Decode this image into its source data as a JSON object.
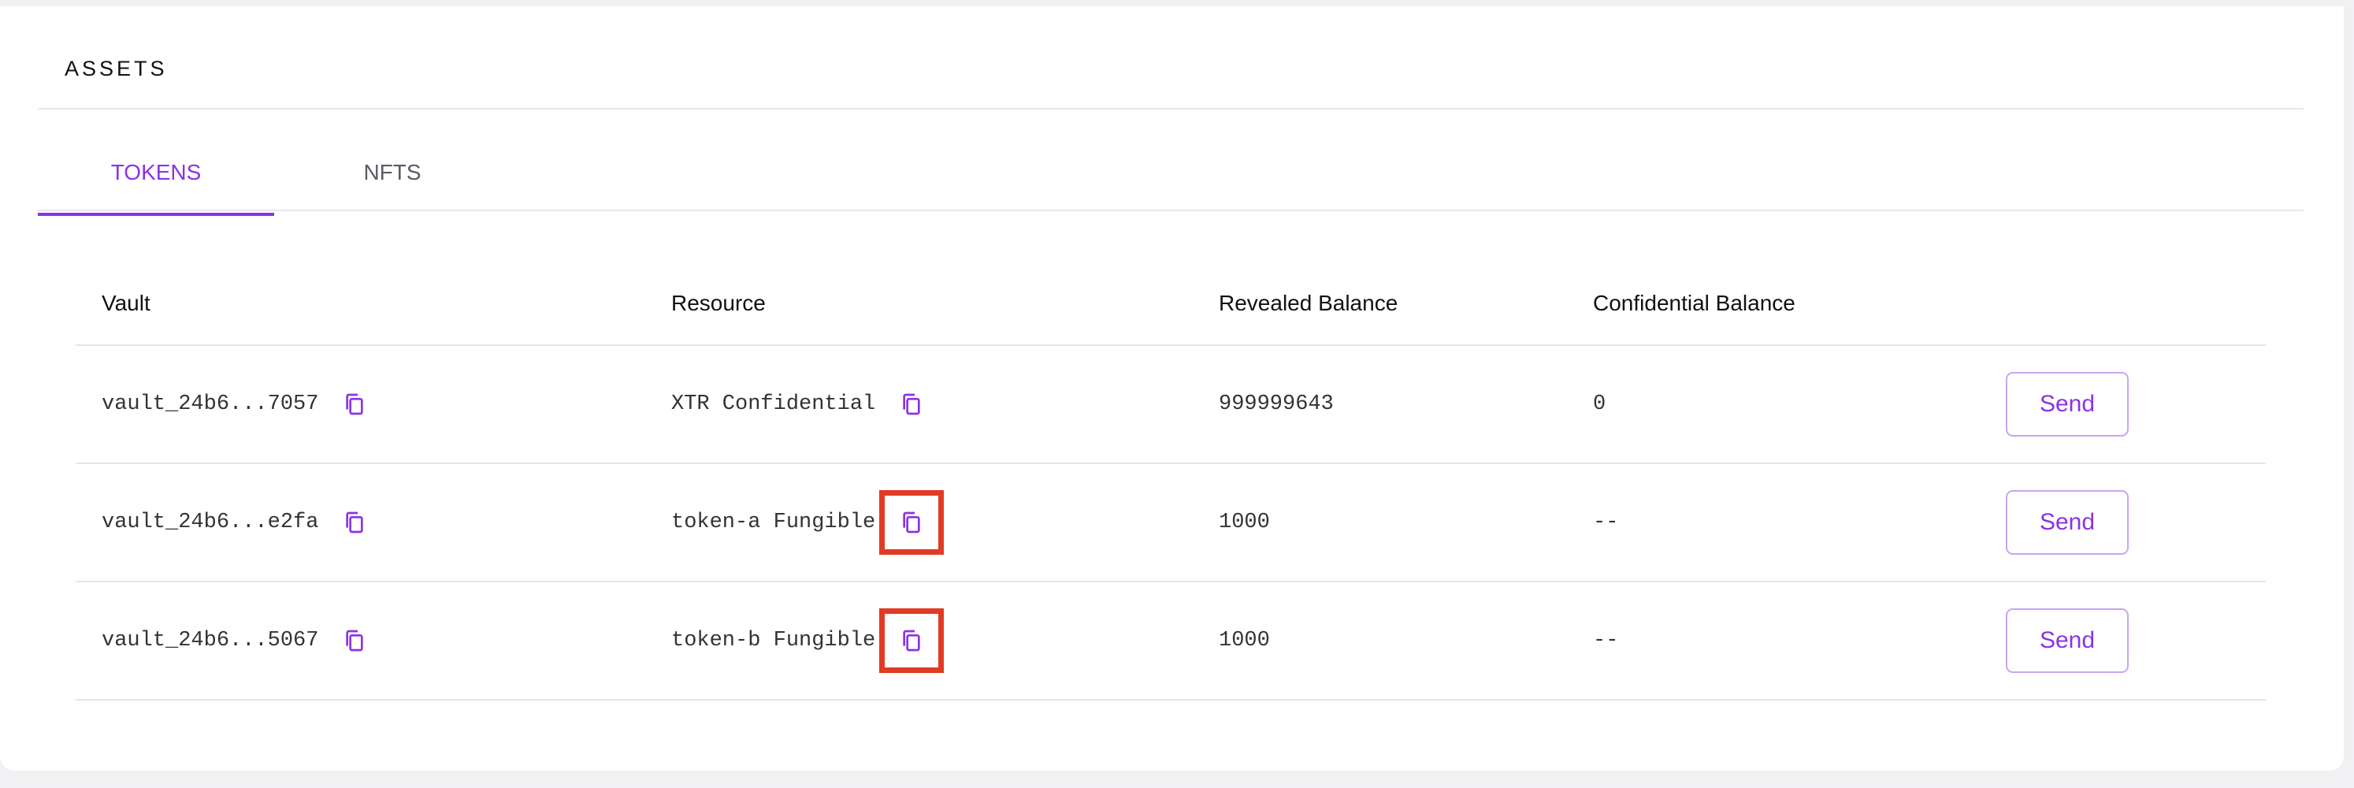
{
  "assets": {
    "title": "ASSETS",
    "tabs": [
      {
        "label": "TOKENS",
        "active": true
      },
      {
        "label": "NFTS",
        "active": false
      }
    ],
    "table": {
      "headers": [
        "Vault",
        "Resource",
        "Revealed Balance",
        "Confidential Balance",
        ""
      ],
      "rows": [
        {
          "vault": "vault_24b6...7057",
          "resource": "XTR Confidential",
          "revealed": "999999643",
          "confidential": "0",
          "action": "Send",
          "resource_copy_highlighted": false
        },
        {
          "vault": "vault_24b6...e2fa",
          "resource": "token-a Fungible",
          "revealed": "1000",
          "confidential": "--",
          "action": "Send",
          "resource_copy_highlighted": true
        },
        {
          "vault": "vault_24b6...5067",
          "resource": "token-b Fungible",
          "revealed": "1000",
          "confidential": "--",
          "action": "Send",
          "resource_copy_highlighted": true
        }
      ]
    }
  },
  "icons": {
    "copy": "copy-icon"
  },
  "colors": {
    "accent": "#8a33e6",
    "highlight": "#e03b24",
    "divider": "#e6e6ea"
  }
}
